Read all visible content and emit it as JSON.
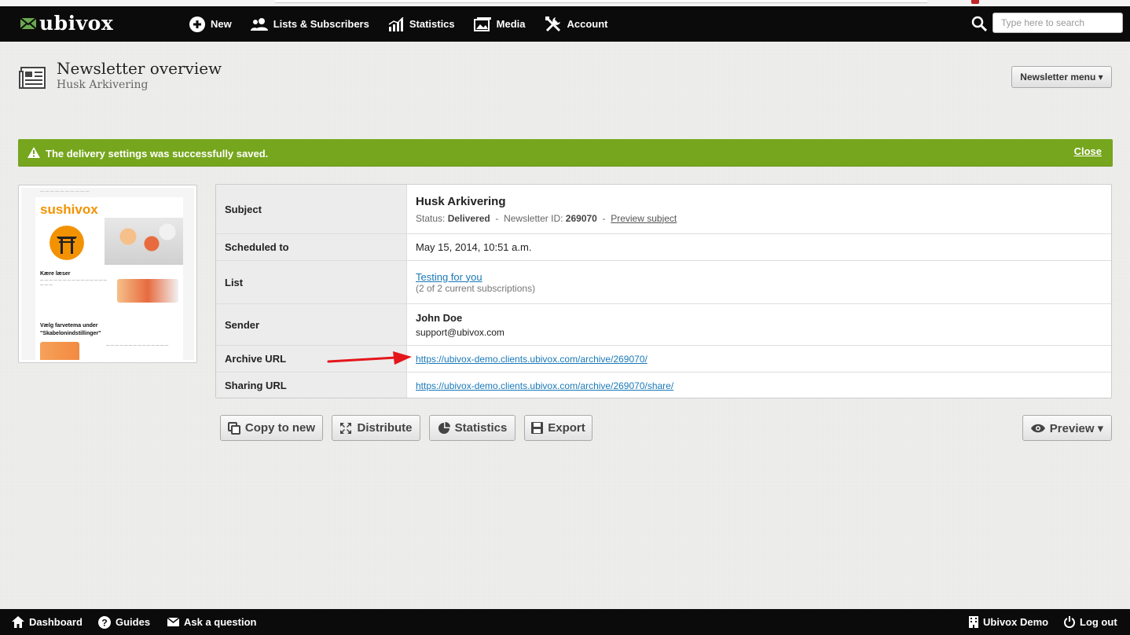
{
  "nav": {
    "logo": "ubivox",
    "items": [
      {
        "label": "New",
        "icon": "plus-circle-icon"
      },
      {
        "label": "Lists & Subscribers",
        "icon": "users-icon"
      },
      {
        "label": "Statistics",
        "icon": "chart-icon"
      },
      {
        "label": "Media",
        "icon": "image-icon"
      },
      {
        "label": "Account",
        "icon": "tools-icon"
      }
    ],
    "search_placeholder": "Type here to search"
  },
  "header": {
    "title": "Newsletter overview",
    "subtitle": "Husk Arkivering",
    "menu_label": "Newsletter menu ▾"
  },
  "alert": {
    "message": "The delivery settings was successfully saved.",
    "close_label": "Close",
    "color": "#76a61d"
  },
  "thumbnail": {
    "brand": "sushivox",
    "heading1": "Kære læser",
    "heading2": "Vælg farvetema under",
    "heading3": "\"Skabelonindstillinger\""
  },
  "details": {
    "subject": {
      "label": "Subject",
      "title": "Husk Arkivering",
      "status_label": "Status:",
      "status": "Delivered",
      "id_label": "Newsletter ID:",
      "id": "269070",
      "preview_link": "Preview subject"
    },
    "scheduled": {
      "label": "Scheduled to",
      "value": "May 15, 2014, 10:51 a.m."
    },
    "list": {
      "label": "List",
      "link": "Testing for you",
      "note": "(2 of 2 current subscriptions)"
    },
    "sender": {
      "label": "Sender",
      "name": "John Doe",
      "email": "support@ubivox.com"
    },
    "archive": {
      "label": "Archive URL",
      "url": "https://ubivox-demo.clients.ubivox.com/archive/269070/"
    },
    "sharing": {
      "label": "Sharing URL",
      "url": "https://ubivox-demo.clients.ubivox.com/archive/269070/share/"
    }
  },
  "actions": {
    "copy": "Copy to new",
    "distribute": "Distribute",
    "statistics": "Statistics",
    "export": "Export",
    "preview": "Preview ▾"
  },
  "footer": {
    "dashboard": "Dashboard",
    "guides": "Guides",
    "ask": "Ask a question",
    "account": "Ubivox Demo",
    "logout": "Log out"
  },
  "colors": {
    "link": "#1a79b8",
    "topbar": "#0b0b0b",
    "arrow": "#e3161b"
  }
}
